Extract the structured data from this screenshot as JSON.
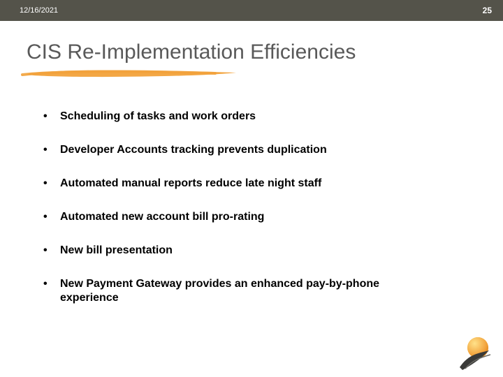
{
  "header": {
    "date": "12/16/2021",
    "page_number": "25"
  },
  "title": "CIS Re-Implementation Efficiencies",
  "accent_color": "#f2a23b",
  "bullets": [
    "Scheduling of tasks and work orders",
    "Developer Accounts tracking prevents duplication",
    "Automated manual reports reduce late night staff",
    "Automated new account bill pro-rating",
    "New bill presentation",
    "New Payment Gateway provides an enhanced pay-by-phone experience"
  ]
}
